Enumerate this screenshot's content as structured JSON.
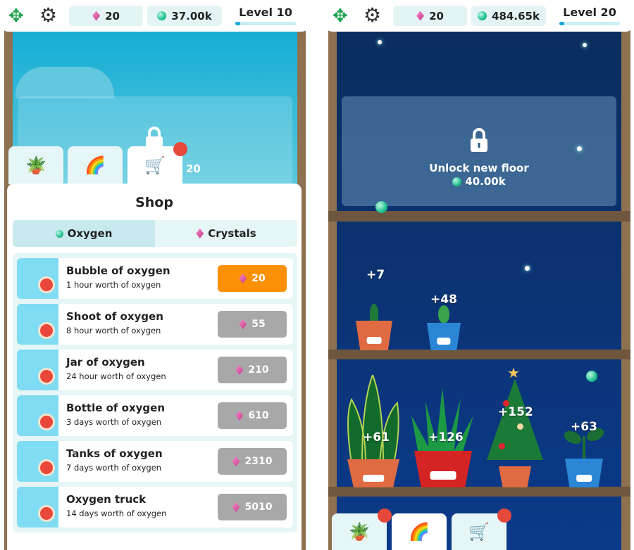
{
  "left": {
    "crystals": "20",
    "oxygen": "37.00k",
    "level": "Level 10",
    "level_progress": 0.03,
    "bg_partial_text": "20",
    "tabs": [
      {
        "icon": "cactus-icon"
      },
      {
        "icon": "rainbow-icon"
      },
      {
        "icon": "shopping-cart-icon",
        "active": true,
        "badge": true
      }
    ],
    "shop": {
      "title": "Shop",
      "subtabs": [
        {
          "label": "Oxygen",
          "active": true
        },
        {
          "label": "Crystals"
        }
      ],
      "items": [
        {
          "name": "Bubble of oxygen",
          "desc": "1 hour worth of oxygen",
          "price": "20",
          "affordable": true
        },
        {
          "name": "Shoot of oxygen",
          "desc": "8 hour worth of oxygen",
          "price": "55"
        },
        {
          "name": "Jar of oxygen",
          "desc": "24 hour worth of oxygen",
          "price": "210"
        },
        {
          "name": "Bottle of oxygen",
          "desc": "3 days worth of oxygen",
          "price": "610"
        },
        {
          "name": "Tanks of oxygen",
          "desc": "7 days worth of oxygen",
          "price": "2310"
        },
        {
          "name": "Oxygen truck",
          "desc": "14 days worth of oxygen",
          "price": "5010"
        }
      ]
    }
  },
  "right": {
    "crystals": "20",
    "oxygen": "484.65k",
    "level": "Level 20",
    "level_progress": 0.03,
    "unlock": {
      "label": "Unlock new floor",
      "cost": "40.00k"
    },
    "shelf1": [
      "+7",
      "+48"
    ],
    "shelf2": [
      "+61",
      "+126",
      "+152",
      "+63"
    ],
    "tabs": [
      {
        "icon": "cactus-icon",
        "badge": true
      },
      {
        "icon": "rainbow-icon",
        "active": true
      },
      {
        "icon": "shopping-cart-icon",
        "badge": true
      }
    ]
  },
  "colors": {
    "accent_orange": "#fb9004",
    "crystal": "#d9479e",
    "oxygen": "#1fc08e",
    "sky_day": "#1fb4d6",
    "sky_night": "#0d3470",
    "wood": "#8d7150"
  }
}
